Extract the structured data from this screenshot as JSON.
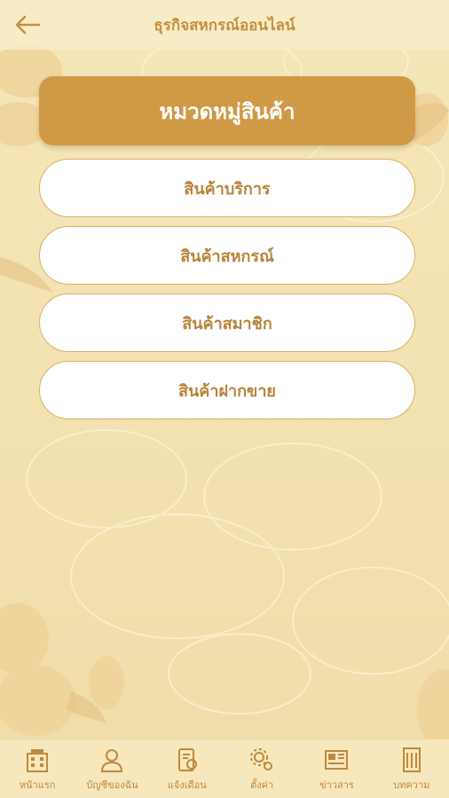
{
  "header": {
    "title": "ธุรกิจสหกรณ์ออนไลน์",
    "back_icon": "arrow-left-icon"
  },
  "category": {
    "title": "หมวดหมู่สินค้า"
  },
  "menu": [
    {
      "label": "สินค้าบริการ"
    },
    {
      "label": "สินค้าสหกรณ์"
    },
    {
      "label": "สินค้าสมาชิก"
    },
    {
      "label": "สินค้าฝากขาย"
    }
  ],
  "bottom_nav": [
    {
      "label": "หน้าแรก",
      "icon": "building-icon"
    },
    {
      "label": "บัญชีของฉัน",
      "icon": "user-account-icon"
    },
    {
      "label": "แจ้งเตือน",
      "icon": "notification-icon"
    },
    {
      "label": "ตั้งค่า",
      "icon": "settings-icon"
    },
    {
      "label": "ข่าวสาร",
      "icon": "newspaper-icon"
    },
    {
      "label": "บทความ",
      "icon": "article-icon"
    }
  ],
  "colors": {
    "accent": "#cf9a46",
    "text_gold": "#b8843a",
    "background": "#f3e3b4"
  }
}
